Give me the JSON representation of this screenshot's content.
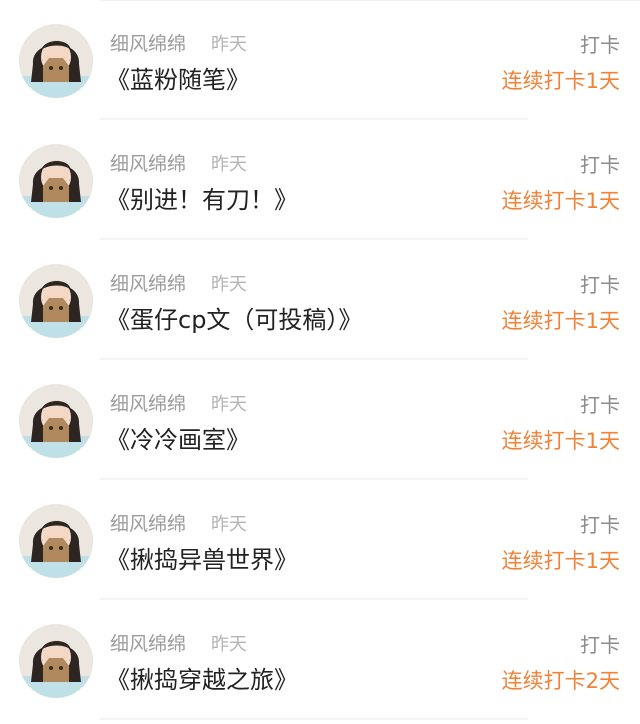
{
  "colors": {
    "name": "#9c9c9c",
    "time": "#b4b4b4",
    "title": "#222222",
    "action": "#8c8c8c",
    "streak_accent": "#f08237"
  },
  "icons": {
    "avatar": "user-avatar-photo"
  },
  "feed": {
    "items": [
      {
        "name": "细风绵绵",
        "time": "昨天",
        "title": "《蓝粉随笔》",
        "action": "打卡",
        "streak": "连续打卡1天"
      },
      {
        "name": "细风绵绵",
        "time": "昨天",
        "title": "《别进！有刀！》",
        "action": "打卡",
        "streak": "连续打卡1天"
      },
      {
        "name": "细风绵绵",
        "time": "昨天",
        "title": "《蛋仔cp文（可投稿）》",
        "action": "打卡",
        "streak": "连续打卡1天"
      },
      {
        "name": "细风绵绵",
        "time": "昨天",
        "title": "《冷冷画室》",
        "action": "打卡",
        "streak": "连续打卡1天"
      },
      {
        "name": "细风绵绵",
        "time": "昨天",
        "title": "《揪捣异兽世界》",
        "action": "打卡",
        "streak": "连续打卡1天"
      },
      {
        "name": "细风绵绵",
        "time": "昨天",
        "title": "《揪捣穿越之旅》",
        "action": "打卡",
        "streak": "连续打卡2天"
      }
    ]
  }
}
